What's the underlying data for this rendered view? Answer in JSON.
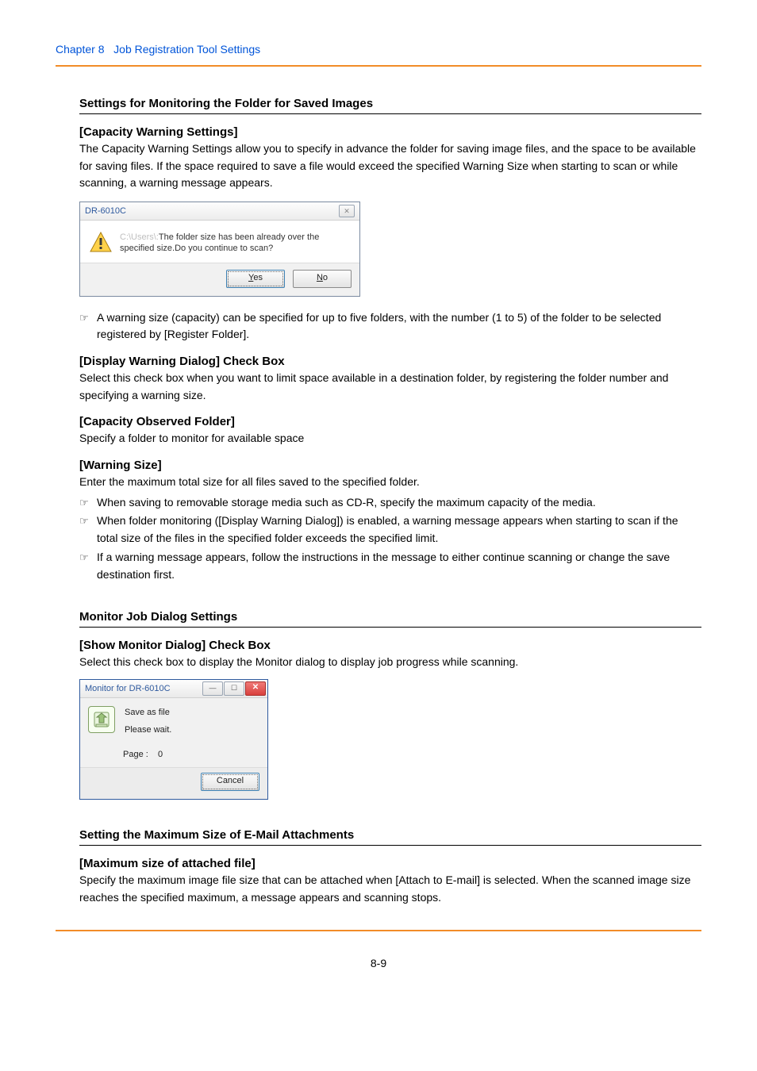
{
  "chapter": {
    "number": "Chapter 8",
    "title": "Job Registration Tool Settings"
  },
  "section1": {
    "title": "Settings for Monitoring the Folder for Saved Images",
    "capacity_warning": {
      "heading": "[Capacity Warning Settings]",
      "body": "The Capacity Warning Settings allow you to specify in advance the folder for saving image files, and the space to be available for saving files. If the space required to save a file would exceed the specified Warning Size when starting to scan or while scanning, a warning message appears."
    },
    "dialog": {
      "title": "DR-6010C",
      "msg_path": "C:\\Users\\:",
      "msg_text": "The folder size has been already over the specified size.Do you continue to scan?",
      "btn_yes_pre": "",
      "btn_yes_key": "Y",
      "btn_yes_post": "es",
      "btn_no_pre": "",
      "btn_no_key": "N",
      "btn_no_post": "o"
    },
    "note1": "A warning size (capacity) can be specified for up to five folders, with the number (1 to 5) of the folder to be selected registered by [Register Folder].",
    "display_warning": {
      "heading": "[Display Warning Dialog] Check Box",
      "body": "Select this check box when you want to limit space available in a destination folder, by registering the folder number and specifying a warning size."
    },
    "observed_folder": {
      "heading": "[Capacity Observed Folder]",
      "body": "Specify a folder to monitor for available space"
    },
    "warning_size": {
      "heading": "[Warning Size]",
      "body": "Enter the maximum total size for all files saved to the specified folder.",
      "notes": [
        "When saving to removable storage media such as CD-R, specify the maximum capacity of the media.",
        "When folder monitoring ([Display Warning Dialog]) is enabled, a warning message appears when starting to scan if the total size of the files in the specified folder exceeds the specified limit.",
        "If a warning message appears, follow the instructions in the message to either continue scanning or change the save destination first."
      ]
    }
  },
  "section2": {
    "title": "Monitor Job Dialog Settings",
    "show_monitor": {
      "heading": "[Show Monitor Dialog] Check Box",
      "body": "Select this check box to display the Monitor dialog to display job progress while scanning."
    },
    "dialog": {
      "title": "Monitor for DR-6010C",
      "line1": "Save as file",
      "line2": "Please wait.",
      "page_label": "Page :",
      "page_value": "0",
      "cancel_label": "Cancel"
    }
  },
  "section3": {
    "title": "Setting the Maximum Size of E-Mail Attachments",
    "max_size": {
      "heading": "[Maximum size of attached file]",
      "body": "Specify the maximum image file size that can be attached when [Attach to E-mail] is selected. When the scanned image size reaches the specified maximum, a message appears and scanning stops."
    }
  },
  "page_number": "8-9"
}
